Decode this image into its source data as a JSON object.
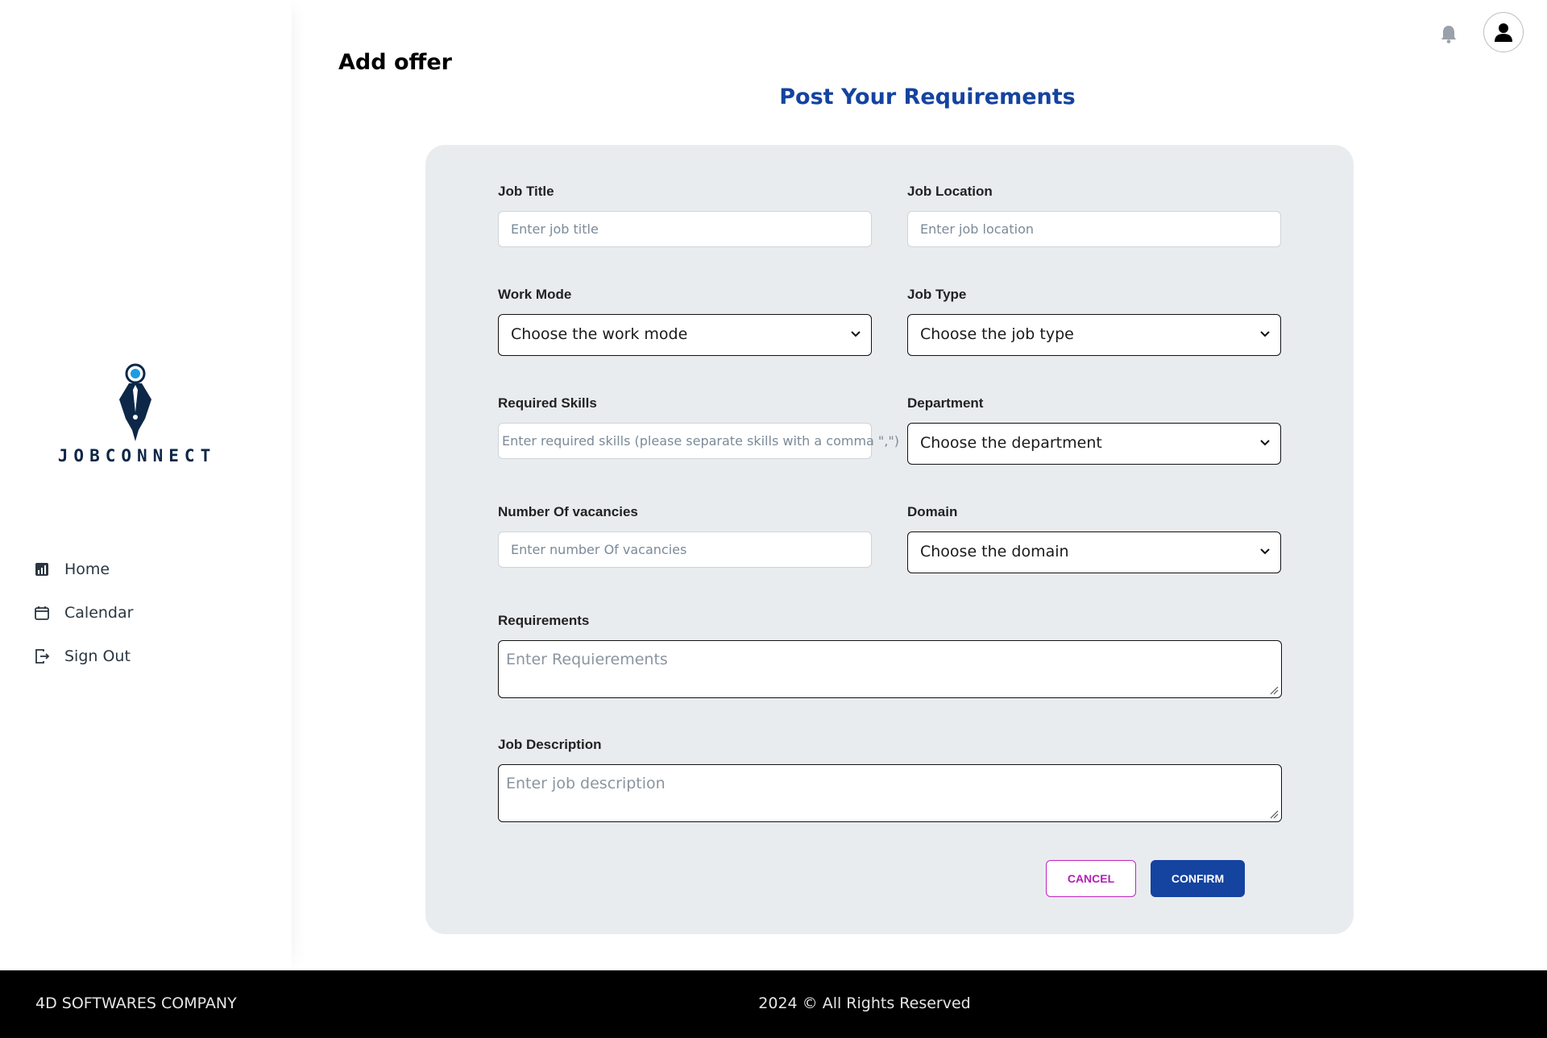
{
  "brand": {
    "name": "JOBCONNECT"
  },
  "sidebar": {
    "items": [
      {
        "label": "Home",
        "icon": "bar-chart-icon"
      },
      {
        "label": "Calendar",
        "icon": "calendar-icon"
      },
      {
        "label": "Sign Out",
        "icon": "sign-out-icon"
      }
    ]
  },
  "header": {
    "notifications_icon": "bell-icon",
    "profile_icon": "user-avatar-icon"
  },
  "page": {
    "title": "Add offer",
    "heading": "Post Your Requirements"
  },
  "form": {
    "job_title": {
      "label": "Job Title",
      "placeholder": "Enter job title"
    },
    "job_location": {
      "label": "Job Location",
      "placeholder": "Enter job location"
    },
    "work_mode": {
      "label": "Work Mode",
      "selected": "Choose the work mode"
    },
    "job_type": {
      "label": "Job Type",
      "selected": "Choose the job type"
    },
    "required_skills": {
      "label": "Required Skills",
      "placeholder": "Enter required skills (please separate skills with a comma \",\")"
    },
    "department": {
      "label": "Department",
      "selected": "Choose the department"
    },
    "vacancies": {
      "label": "Number Of vacancies",
      "placeholder": "Enter number Of vacancies"
    },
    "domain": {
      "label": "Domain",
      "selected": "Choose the domain"
    },
    "requirements": {
      "label": "Requirements",
      "placeholder": "Enter Requierements"
    },
    "job_description": {
      "label": "Job Description",
      "placeholder": "Enter job description"
    },
    "cancel_label": "CANCEL",
    "confirm_label": "CONFIRM"
  },
  "colors": {
    "primary": "#1443a0",
    "cancel": "#b01fb6",
    "card_bg": "#e9ecef",
    "footer_bg": "#000000"
  },
  "footer": {
    "company": "4D SOFTWARES COMPANY",
    "copyright": "2024 © All Rights Reserved"
  }
}
